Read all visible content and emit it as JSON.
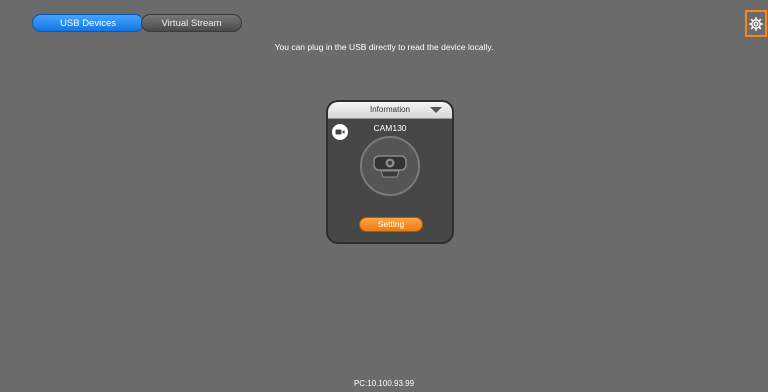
{
  "tabs": [
    {
      "label": "USB Devices",
      "active": true
    },
    {
      "label": "Virtual Stream",
      "active": false
    }
  ],
  "settings_icon": "gear-icon",
  "hint_text": "You can plug in the USB directly to read the device locally.",
  "device_card": {
    "info_label": "Information",
    "info_icon": "caret-down-icon",
    "badge_icon": "video-camera-icon",
    "device_name": "CAM130",
    "device_icon": "webcam-icon",
    "setting_label": "Setting"
  },
  "footer": {
    "ip_text": "PC:10.100.93.99"
  },
  "colors": {
    "background": "#6b6b6b",
    "active_tab": "#1f86f0",
    "accent_orange": "#f08a1c",
    "card_bg": "#474747"
  }
}
